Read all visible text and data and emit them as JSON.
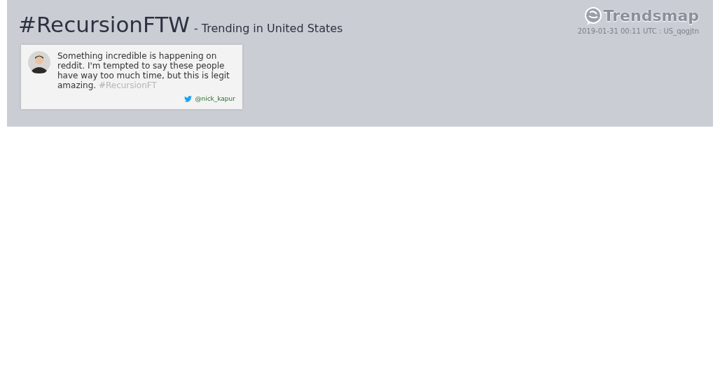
{
  "header": {
    "hashtag": "#RecursionFTW",
    "subtitle": "- Trending in United States",
    "brand": "Trendsmap",
    "timestamp": "2019-01-31 00:11 UTC : US_qogjtn"
  },
  "tweets": [
    {
      "text": "Something incredible is happening on reddit. I'm tempted to say these people have way too much time, but this is legit amazing.",
      "faded_text": "#RecursionFT",
      "author": "@nick_kapur"
    }
  ]
}
